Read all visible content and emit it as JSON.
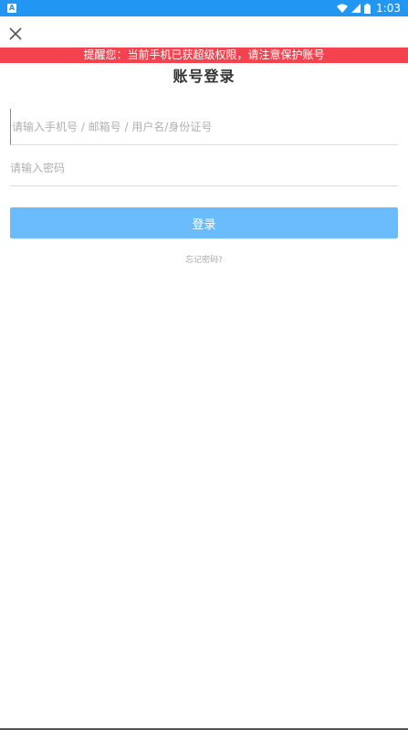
{
  "status_bar": {
    "app_badge": "A",
    "time": "1:03",
    "icons": [
      "wifi-icon",
      "cell-signal-icon",
      "battery-icon"
    ]
  },
  "header": {
    "close_icon": "close-icon"
  },
  "warning": {
    "text": "提醒您：当前手机已获超级权限，请注意保护账号"
  },
  "title": "账号登录",
  "form": {
    "account_placeholder": "请输入手机号 / 邮箱号 / 用户名/身份证号",
    "password_placeholder": "请输入密码",
    "login_label": "登录",
    "forgot_label": "忘记密码?"
  },
  "colors": {
    "status_bar": "#2196f3",
    "warning": "#f5424f",
    "login_button": "#6bbcfc"
  }
}
